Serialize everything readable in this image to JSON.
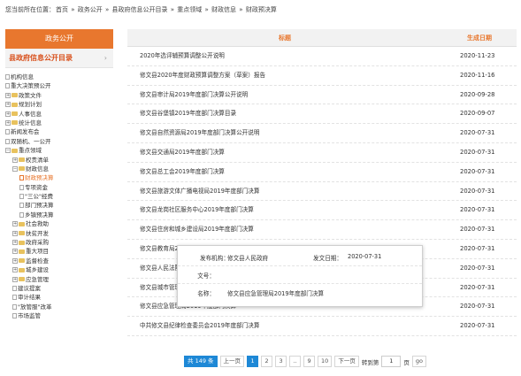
{
  "breadcrumb": {
    "prefix": "您当前所在位置：",
    "items": [
      "首页",
      "政务公开",
      "县政府信息公开目录",
      "重点领域",
      "财政信息",
      "财政预决算"
    ],
    "separator": "»"
  },
  "sidebar": {
    "header": "政务公开",
    "subheader": "县政府信息公开目录",
    "subheader_arrow": "›",
    "tree": [
      {
        "label": "机构信息",
        "kind": "page",
        "depth": 0
      },
      {
        "label": "重大决策预公开",
        "kind": "page",
        "depth": 0
      },
      {
        "label": "政策文件",
        "kind": "folder",
        "depth": 0,
        "toggle": "+"
      },
      {
        "label": "规划计划",
        "kind": "folder",
        "depth": 0,
        "toggle": "+"
      },
      {
        "label": "人事信息",
        "kind": "folder",
        "depth": 0,
        "toggle": "+"
      },
      {
        "label": "统计信息",
        "kind": "folder",
        "depth": 0,
        "toggle": "+"
      },
      {
        "label": "新闻发布会",
        "kind": "page",
        "depth": 0
      },
      {
        "label": "双随机、一公开",
        "kind": "page",
        "depth": 0
      },
      {
        "label": "重点领域",
        "kind": "folder",
        "depth": 0,
        "toggle": "−"
      },
      {
        "label": "权责清单",
        "kind": "folder",
        "depth": 1,
        "toggle": "+"
      },
      {
        "label": "财政信息",
        "kind": "folder",
        "depth": 1,
        "toggle": "−"
      },
      {
        "label": "财政预决算",
        "kind": "page",
        "depth": 2,
        "active": true
      },
      {
        "label": "专项资金",
        "kind": "page",
        "depth": 2
      },
      {
        "label": "\"三公\"经费",
        "kind": "page",
        "depth": 2
      },
      {
        "label": "部门预决算",
        "kind": "page",
        "depth": 2
      },
      {
        "label": "乡镇预决算",
        "kind": "page",
        "depth": 2
      },
      {
        "label": "社会救助",
        "kind": "folder",
        "depth": 1,
        "toggle": "+"
      },
      {
        "label": "扶贫开发",
        "kind": "folder",
        "depth": 1,
        "toggle": "+"
      },
      {
        "label": "政府采购",
        "kind": "folder",
        "depth": 1,
        "toggle": "+"
      },
      {
        "label": "重大项目",
        "kind": "folder",
        "depth": 1,
        "toggle": "+"
      },
      {
        "label": "监督检查",
        "kind": "folder",
        "depth": 1,
        "toggle": "+"
      },
      {
        "label": "城乡建设",
        "kind": "folder",
        "depth": 1,
        "toggle": "+"
      },
      {
        "label": "应急管理",
        "kind": "folder",
        "depth": 1,
        "toggle": "+"
      },
      {
        "label": "建议提案",
        "kind": "page",
        "depth": 1
      },
      {
        "label": "审计结果",
        "kind": "page",
        "depth": 1
      },
      {
        "label": "\"放管服\"改革",
        "kind": "page",
        "depth": 1
      },
      {
        "label": "市场监管",
        "kind": "page",
        "depth": 1
      }
    ]
  },
  "table": {
    "col_title": "标题",
    "col_date": "生成日期",
    "rows": [
      {
        "title": "2020年选评辅预算调整公开说明",
        "date": "2020-11-23"
      },
      {
        "title": "修文县2020年度财政预算调整方案（草案）报告",
        "date": "2020-11-16"
      },
      {
        "title": "修文县审计局2019年度部门决算公开说明",
        "date": "2020-09-28"
      },
      {
        "title": "修文县谷堡镇2019年度部门决算目录",
        "date": "2020-09-07"
      },
      {
        "title": "修文县自然资源局2019年度部门决算公开说明",
        "date": "2020-07-31"
      },
      {
        "title": "修文县交通局2019年度部门决算",
        "date": "2020-07-31"
      },
      {
        "title": "修文县总工会2019年度部门决算",
        "date": "2020-07-31"
      },
      {
        "title": "修文县旅游文体广播电视局2019年度部门决算",
        "date": "2020-07-31"
      },
      {
        "title": "修文县龙岗社区服务中心2019年度部门决算",
        "date": "2020-07-31"
      },
      {
        "title": "修文县住房和城乡建设局2019年度部门决算",
        "date": "2020-07-31"
      },
      {
        "title": "修文县教育局2019年度部门决算",
        "date": "2020-07-31"
      },
      {
        "title": "修文县人民法院2019年度部门决算",
        "date": "2020-07-31"
      },
      {
        "title": "修文县城市管理局2019年度部门决算",
        "date": "2020-07-31"
      },
      {
        "title": "修文县应急管理局2019年度部门决算",
        "date": "2020-07-31"
      },
      {
        "title": "中共修文县纪律检查委员会2019年度部门决算",
        "date": "2020-07-31"
      }
    ]
  },
  "popup": {
    "publisher_label": "发布机构：",
    "publisher_value": "修文县人民政府",
    "pubdate_label": "发文日期：",
    "pubdate_value": "2020-07-31",
    "docno_label": "文号：",
    "docno_value": "",
    "name_label": "名称：",
    "name_value": "修文县应急管理局2019年度部门决算"
  },
  "pager": {
    "total": "共 149 条",
    "prev": "上一页",
    "pages": [
      "1",
      "2",
      "3",
      "..",
      "9",
      "10"
    ],
    "current": "1",
    "next": "下一页",
    "goto_label": "转到第",
    "goto_value": "1",
    "page_unit": "页",
    "go": "go"
  }
}
